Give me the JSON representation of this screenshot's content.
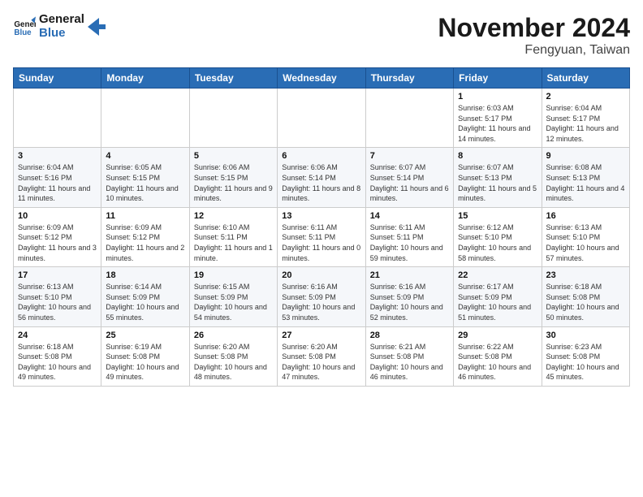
{
  "logo": {
    "line1": "General",
    "line2": "Blue"
  },
  "title": "November 2024",
  "subtitle": "Fengyuan, Taiwan",
  "weekdays": [
    "Sunday",
    "Monday",
    "Tuesday",
    "Wednesday",
    "Thursday",
    "Friday",
    "Saturday"
  ],
  "weeks": [
    [
      {
        "day": "",
        "info": ""
      },
      {
        "day": "",
        "info": ""
      },
      {
        "day": "",
        "info": ""
      },
      {
        "day": "",
        "info": ""
      },
      {
        "day": "",
        "info": ""
      },
      {
        "day": "1",
        "info": "Sunrise: 6:03 AM\nSunset: 5:17 PM\nDaylight: 11 hours and 14 minutes."
      },
      {
        "day": "2",
        "info": "Sunrise: 6:04 AM\nSunset: 5:17 PM\nDaylight: 11 hours and 12 minutes."
      }
    ],
    [
      {
        "day": "3",
        "info": "Sunrise: 6:04 AM\nSunset: 5:16 PM\nDaylight: 11 hours and 11 minutes."
      },
      {
        "day": "4",
        "info": "Sunrise: 6:05 AM\nSunset: 5:15 PM\nDaylight: 11 hours and 10 minutes."
      },
      {
        "day": "5",
        "info": "Sunrise: 6:06 AM\nSunset: 5:15 PM\nDaylight: 11 hours and 9 minutes."
      },
      {
        "day": "6",
        "info": "Sunrise: 6:06 AM\nSunset: 5:14 PM\nDaylight: 11 hours and 8 minutes."
      },
      {
        "day": "7",
        "info": "Sunrise: 6:07 AM\nSunset: 5:14 PM\nDaylight: 11 hours and 6 minutes."
      },
      {
        "day": "8",
        "info": "Sunrise: 6:07 AM\nSunset: 5:13 PM\nDaylight: 11 hours and 5 minutes."
      },
      {
        "day": "9",
        "info": "Sunrise: 6:08 AM\nSunset: 5:13 PM\nDaylight: 11 hours and 4 minutes."
      }
    ],
    [
      {
        "day": "10",
        "info": "Sunrise: 6:09 AM\nSunset: 5:12 PM\nDaylight: 11 hours and 3 minutes."
      },
      {
        "day": "11",
        "info": "Sunrise: 6:09 AM\nSunset: 5:12 PM\nDaylight: 11 hours and 2 minutes."
      },
      {
        "day": "12",
        "info": "Sunrise: 6:10 AM\nSunset: 5:11 PM\nDaylight: 11 hours and 1 minute."
      },
      {
        "day": "13",
        "info": "Sunrise: 6:11 AM\nSunset: 5:11 PM\nDaylight: 11 hours and 0 minutes."
      },
      {
        "day": "14",
        "info": "Sunrise: 6:11 AM\nSunset: 5:11 PM\nDaylight: 10 hours and 59 minutes."
      },
      {
        "day": "15",
        "info": "Sunrise: 6:12 AM\nSunset: 5:10 PM\nDaylight: 10 hours and 58 minutes."
      },
      {
        "day": "16",
        "info": "Sunrise: 6:13 AM\nSunset: 5:10 PM\nDaylight: 10 hours and 57 minutes."
      }
    ],
    [
      {
        "day": "17",
        "info": "Sunrise: 6:13 AM\nSunset: 5:10 PM\nDaylight: 10 hours and 56 minutes."
      },
      {
        "day": "18",
        "info": "Sunrise: 6:14 AM\nSunset: 5:09 PM\nDaylight: 10 hours and 55 minutes."
      },
      {
        "day": "19",
        "info": "Sunrise: 6:15 AM\nSunset: 5:09 PM\nDaylight: 10 hours and 54 minutes."
      },
      {
        "day": "20",
        "info": "Sunrise: 6:16 AM\nSunset: 5:09 PM\nDaylight: 10 hours and 53 minutes."
      },
      {
        "day": "21",
        "info": "Sunrise: 6:16 AM\nSunset: 5:09 PM\nDaylight: 10 hours and 52 minutes."
      },
      {
        "day": "22",
        "info": "Sunrise: 6:17 AM\nSunset: 5:09 PM\nDaylight: 10 hours and 51 minutes."
      },
      {
        "day": "23",
        "info": "Sunrise: 6:18 AM\nSunset: 5:08 PM\nDaylight: 10 hours and 50 minutes."
      }
    ],
    [
      {
        "day": "24",
        "info": "Sunrise: 6:18 AM\nSunset: 5:08 PM\nDaylight: 10 hours and 49 minutes."
      },
      {
        "day": "25",
        "info": "Sunrise: 6:19 AM\nSunset: 5:08 PM\nDaylight: 10 hours and 49 minutes."
      },
      {
        "day": "26",
        "info": "Sunrise: 6:20 AM\nSunset: 5:08 PM\nDaylight: 10 hours and 48 minutes."
      },
      {
        "day": "27",
        "info": "Sunrise: 6:20 AM\nSunset: 5:08 PM\nDaylight: 10 hours and 47 minutes."
      },
      {
        "day": "28",
        "info": "Sunrise: 6:21 AM\nSunset: 5:08 PM\nDaylight: 10 hours and 46 minutes."
      },
      {
        "day": "29",
        "info": "Sunrise: 6:22 AM\nSunset: 5:08 PM\nDaylight: 10 hours and 46 minutes."
      },
      {
        "day": "30",
        "info": "Sunrise: 6:23 AM\nSunset: 5:08 PM\nDaylight: 10 hours and 45 minutes."
      }
    ]
  ]
}
